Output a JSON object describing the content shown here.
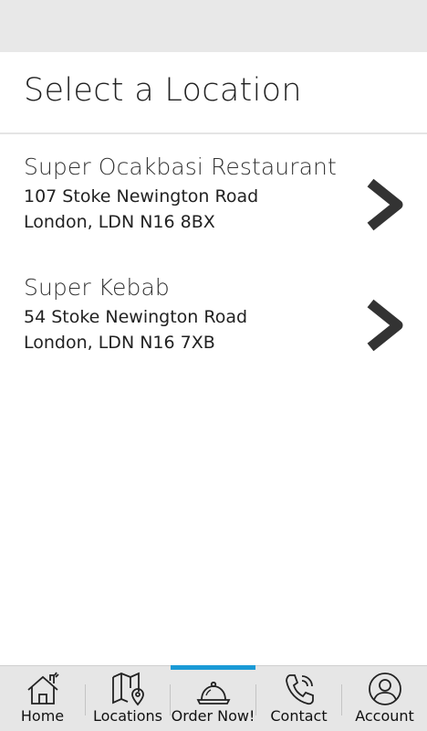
{
  "header": {
    "title": "Select a Location"
  },
  "locations": [
    {
      "name": "Super Ocakbasi Restaurant",
      "address_line1": "107 Stoke Newington Road",
      "address_line2": "London, LDN N16 8BX"
    },
    {
      "name": "Super Kebab",
      "address_line1": "54 Stoke Newington Road",
      "address_line2": "London, LDN N16 7XB"
    }
  ],
  "tabs": [
    {
      "label": "Home",
      "icon": "home-icon"
    },
    {
      "label": "Locations",
      "icon": "map-pin-icon"
    },
    {
      "label": "Order Now!",
      "icon": "cloche-icon",
      "active": true
    },
    {
      "label": "Contact",
      "icon": "phone-icon"
    },
    {
      "label": "Account",
      "icon": "account-icon"
    }
  ],
  "colors": {
    "active_tab_indicator": "#1a9ad6",
    "chevron": "#333333",
    "tab_bar_bg": "#e6e6e6"
  }
}
